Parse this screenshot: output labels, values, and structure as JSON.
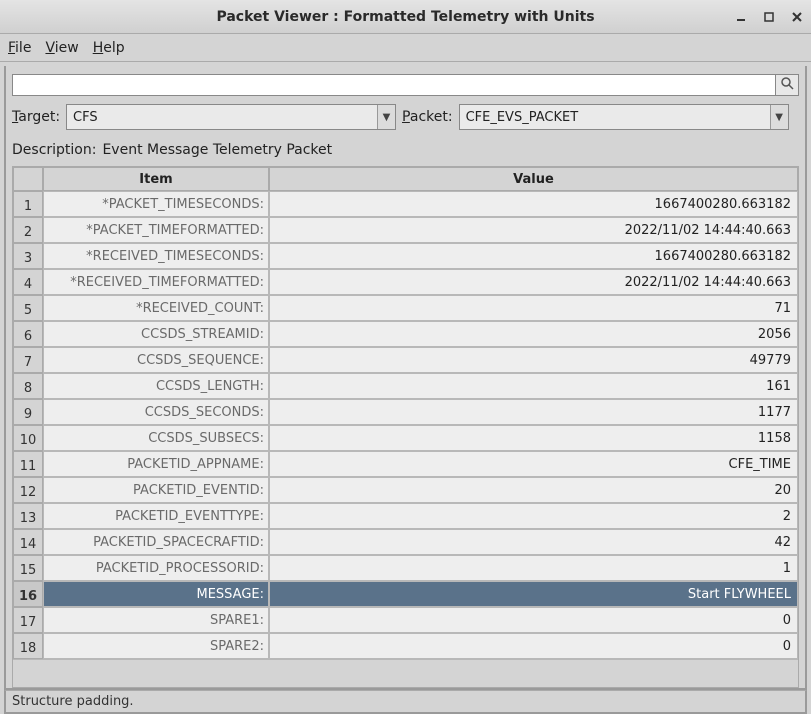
{
  "window": {
    "title": "Packet Viewer : Formatted Telemetry with Units"
  },
  "menu": {
    "file": "File",
    "view": "View",
    "help": "Help"
  },
  "search": {
    "value": "",
    "placeholder": ""
  },
  "selectors": {
    "target_label": "Target:",
    "target_value": "CFS",
    "packet_label": "Packet:",
    "packet_value": "CFE_EVS_PACKET"
  },
  "description": {
    "label": "Description:",
    "text": "Event Message Telemetry Packet"
  },
  "table": {
    "headers": {
      "item": "Item",
      "value": "Value"
    },
    "rows": [
      {
        "n": "1",
        "item": "*PACKET_TIMESECONDS:",
        "value": "1667400280.663182"
      },
      {
        "n": "2",
        "item": "*PACKET_TIMEFORMATTED:",
        "value": "2022/11/02 14:44:40.663"
      },
      {
        "n": "3",
        "item": "*RECEIVED_TIMESECONDS:",
        "value": "1667400280.663182"
      },
      {
        "n": "4",
        "item": "*RECEIVED_TIMEFORMATTED:",
        "value": "2022/11/02 14:44:40.663"
      },
      {
        "n": "5",
        "item": "*RECEIVED_COUNT:",
        "value": "71"
      },
      {
        "n": "6",
        "item": "CCSDS_STREAMID:",
        "value": "2056"
      },
      {
        "n": "7",
        "item": "CCSDS_SEQUENCE:",
        "value": "49779"
      },
      {
        "n": "8",
        "item": "CCSDS_LENGTH:",
        "value": "161"
      },
      {
        "n": "9",
        "item": "CCSDS_SECONDS:",
        "value": "1177"
      },
      {
        "n": "10",
        "item": "CCSDS_SUBSECS:",
        "value": "1158"
      },
      {
        "n": "11",
        "item": "PACKETID_APPNAME:",
        "value": "CFE_TIME"
      },
      {
        "n": "12",
        "item": "PACKETID_EVENTID:",
        "value": "20"
      },
      {
        "n": "13",
        "item": "PACKETID_EVENTTYPE:",
        "value": "2"
      },
      {
        "n": "14",
        "item": "PACKETID_SPACECRAFTID:",
        "value": "42"
      },
      {
        "n": "15",
        "item": "PACKETID_PROCESSORID:",
        "value": "1"
      },
      {
        "n": "16",
        "item": "MESSAGE:",
        "value": "Start FLYWHEEL",
        "selected": true
      },
      {
        "n": "17",
        "item": "SPARE1:",
        "value": "0"
      },
      {
        "n": "18",
        "item": "SPARE2:",
        "value": "0"
      }
    ]
  },
  "status": {
    "text": "Structure padding."
  }
}
